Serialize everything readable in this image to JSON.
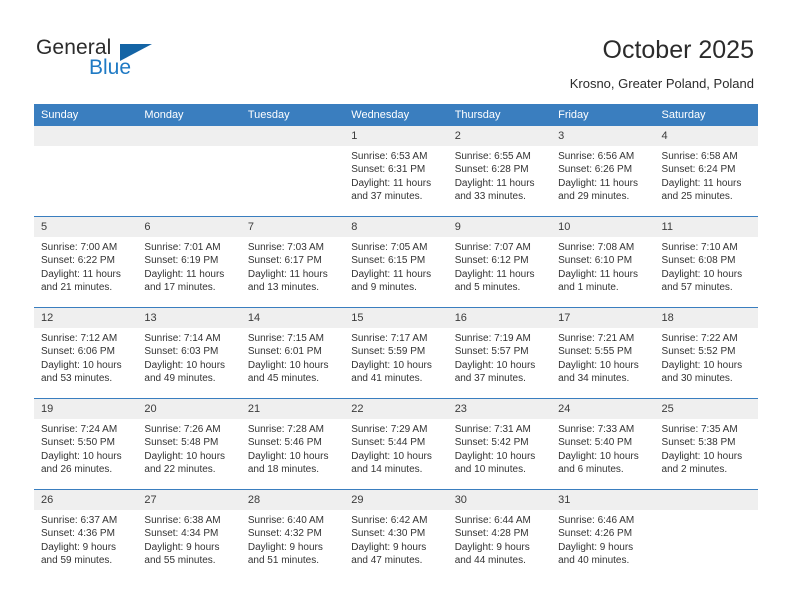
{
  "brand": {
    "name_top": "General",
    "name_bottom": "Blue",
    "flag_icon": "flag-triangle-icon",
    "accent_color": "#1f7ac4",
    "flag_color": "#1464a5"
  },
  "header": {
    "title": "October 2025",
    "subtitle": "Krosno, Greater Poland, Poland"
  },
  "calendar": {
    "header_bg": "#3a7ebf",
    "daynum_bg": "#efefef",
    "weekdays": [
      "Sunday",
      "Monday",
      "Tuesday",
      "Wednesday",
      "Thursday",
      "Friday",
      "Saturday"
    ],
    "weeks": [
      [
        {
          "day": "",
          "empty": true
        },
        {
          "day": "",
          "empty": true
        },
        {
          "day": "",
          "empty": true
        },
        {
          "day": "1",
          "sunrise": "Sunrise: 6:53 AM",
          "sunset": "Sunset: 6:31 PM",
          "daylight": "Daylight: 11 hours and 37 minutes."
        },
        {
          "day": "2",
          "sunrise": "Sunrise: 6:55 AM",
          "sunset": "Sunset: 6:28 PM",
          "daylight": "Daylight: 11 hours and 33 minutes."
        },
        {
          "day": "3",
          "sunrise": "Sunrise: 6:56 AM",
          "sunset": "Sunset: 6:26 PM",
          "daylight": "Daylight: 11 hours and 29 minutes."
        },
        {
          "day": "4",
          "sunrise": "Sunrise: 6:58 AM",
          "sunset": "Sunset: 6:24 PM",
          "daylight": "Daylight: 11 hours and 25 minutes."
        }
      ],
      [
        {
          "day": "5",
          "sunrise": "Sunrise: 7:00 AM",
          "sunset": "Sunset: 6:22 PM",
          "daylight": "Daylight: 11 hours and 21 minutes."
        },
        {
          "day": "6",
          "sunrise": "Sunrise: 7:01 AM",
          "sunset": "Sunset: 6:19 PM",
          "daylight": "Daylight: 11 hours and 17 minutes."
        },
        {
          "day": "7",
          "sunrise": "Sunrise: 7:03 AM",
          "sunset": "Sunset: 6:17 PM",
          "daylight": "Daylight: 11 hours and 13 minutes."
        },
        {
          "day": "8",
          "sunrise": "Sunrise: 7:05 AM",
          "sunset": "Sunset: 6:15 PM",
          "daylight": "Daylight: 11 hours and 9 minutes."
        },
        {
          "day": "9",
          "sunrise": "Sunrise: 7:07 AM",
          "sunset": "Sunset: 6:12 PM",
          "daylight": "Daylight: 11 hours and 5 minutes."
        },
        {
          "day": "10",
          "sunrise": "Sunrise: 7:08 AM",
          "sunset": "Sunset: 6:10 PM",
          "daylight": "Daylight: 11 hours and 1 minute."
        },
        {
          "day": "11",
          "sunrise": "Sunrise: 7:10 AM",
          "sunset": "Sunset: 6:08 PM",
          "daylight": "Daylight: 10 hours and 57 minutes."
        }
      ],
      [
        {
          "day": "12",
          "sunrise": "Sunrise: 7:12 AM",
          "sunset": "Sunset: 6:06 PM",
          "daylight": "Daylight: 10 hours and 53 minutes."
        },
        {
          "day": "13",
          "sunrise": "Sunrise: 7:14 AM",
          "sunset": "Sunset: 6:03 PM",
          "daylight": "Daylight: 10 hours and 49 minutes."
        },
        {
          "day": "14",
          "sunrise": "Sunrise: 7:15 AM",
          "sunset": "Sunset: 6:01 PM",
          "daylight": "Daylight: 10 hours and 45 minutes."
        },
        {
          "day": "15",
          "sunrise": "Sunrise: 7:17 AM",
          "sunset": "Sunset: 5:59 PM",
          "daylight": "Daylight: 10 hours and 41 minutes."
        },
        {
          "day": "16",
          "sunrise": "Sunrise: 7:19 AM",
          "sunset": "Sunset: 5:57 PM",
          "daylight": "Daylight: 10 hours and 37 minutes."
        },
        {
          "day": "17",
          "sunrise": "Sunrise: 7:21 AM",
          "sunset": "Sunset: 5:55 PM",
          "daylight": "Daylight: 10 hours and 34 minutes."
        },
        {
          "day": "18",
          "sunrise": "Sunrise: 7:22 AM",
          "sunset": "Sunset: 5:52 PM",
          "daylight": "Daylight: 10 hours and 30 minutes."
        }
      ],
      [
        {
          "day": "19",
          "sunrise": "Sunrise: 7:24 AM",
          "sunset": "Sunset: 5:50 PM",
          "daylight": "Daylight: 10 hours and 26 minutes."
        },
        {
          "day": "20",
          "sunrise": "Sunrise: 7:26 AM",
          "sunset": "Sunset: 5:48 PM",
          "daylight": "Daylight: 10 hours and 22 minutes."
        },
        {
          "day": "21",
          "sunrise": "Sunrise: 7:28 AM",
          "sunset": "Sunset: 5:46 PM",
          "daylight": "Daylight: 10 hours and 18 minutes."
        },
        {
          "day": "22",
          "sunrise": "Sunrise: 7:29 AM",
          "sunset": "Sunset: 5:44 PM",
          "daylight": "Daylight: 10 hours and 14 minutes."
        },
        {
          "day": "23",
          "sunrise": "Sunrise: 7:31 AM",
          "sunset": "Sunset: 5:42 PM",
          "daylight": "Daylight: 10 hours and 10 minutes."
        },
        {
          "day": "24",
          "sunrise": "Sunrise: 7:33 AM",
          "sunset": "Sunset: 5:40 PM",
          "daylight": "Daylight: 10 hours and 6 minutes."
        },
        {
          "day": "25",
          "sunrise": "Sunrise: 7:35 AM",
          "sunset": "Sunset: 5:38 PM",
          "daylight": "Daylight: 10 hours and 2 minutes."
        }
      ],
      [
        {
          "day": "26",
          "sunrise": "Sunrise: 6:37 AM",
          "sunset": "Sunset: 4:36 PM",
          "daylight": "Daylight: 9 hours and 59 minutes."
        },
        {
          "day": "27",
          "sunrise": "Sunrise: 6:38 AM",
          "sunset": "Sunset: 4:34 PM",
          "daylight": "Daylight: 9 hours and 55 minutes."
        },
        {
          "day": "28",
          "sunrise": "Sunrise: 6:40 AM",
          "sunset": "Sunset: 4:32 PM",
          "daylight": "Daylight: 9 hours and 51 minutes."
        },
        {
          "day": "29",
          "sunrise": "Sunrise: 6:42 AM",
          "sunset": "Sunset: 4:30 PM",
          "daylight": "Daylight: 9 hours and 47 minutes."
        },
        {
          "day": "30",
          "sunrise": "Sunrise: 6:44 AM",
          "sunset": "Sunset: 4:28 PM",
          "daylight": "Daylight: 9 hours and 44 minutes."
        },
        {
          "day": "31",
          "sunrise": "Sunrise: 6:46 AM",
          "sunset": "Sunset: 4:26 PM",
          "daylight": "Daylight: 9 hours and 40 minutes."
        },
        {
          "day": "",
          "empty": true
        }
      ]
    ]
  }
}
